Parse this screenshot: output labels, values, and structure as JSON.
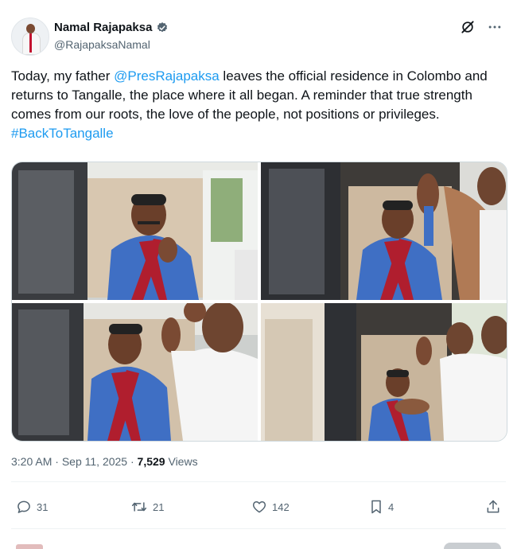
{
  "author": {
    "name": "Namal Rajapaksa",
    "handle": "@RajapaksaNamal",
    "avatar_icon": "profile-photo",
    "verified_icon": "verified-badge-icon",
    "verified_color": "#536471"
  },
  "top_icons": [
    "grok-icon",
    "more-options-icon"
  ],
  "tweet": {
    "text_before": "Today, my father ",
    "mention": "@PresRajapaksa",
    "text_after": " leaves the official residence in Colombo and returns to Tangalle, the place where it all began. A reminder that true strength comes from our roots, the love of the people, not positions or privileges.  ",
    "hashtag": "#BackToTangalle",
    "link_color": "#1d9bf0"
  },
  "media": {
    "photos": [
      {
        "subject": "man-waving-from-car"
      },
      {
        "subject": "man-in-car-greeted-by-crowd"
      },
      {
        "subject": "man-smiling-in-car-with-supporters"
      },
      {
        "subject": "man-waving-from-car-window-crowd"
      }
    ]
  },
  "meta": {
    "time": "3:20 AM",
    "separator": "·",
    "date": "Sep 11, 2025",
    "views_count": "7,529",
    "views_label": "Views"
  },
  "actions": [
    {
      "icon": "reply-icon",
      "count": "31"
    },
    {
      "icon": "repost-icon",
      "count": "21"
    },
    {
      "icon": "like-icon",
      "count": "142"
    },
    {
      "icon": "bookmark-icon",
      "count": "4"
    },
    {
      "icon": "share-icon",
      "count": ""
    }
  ]
}
